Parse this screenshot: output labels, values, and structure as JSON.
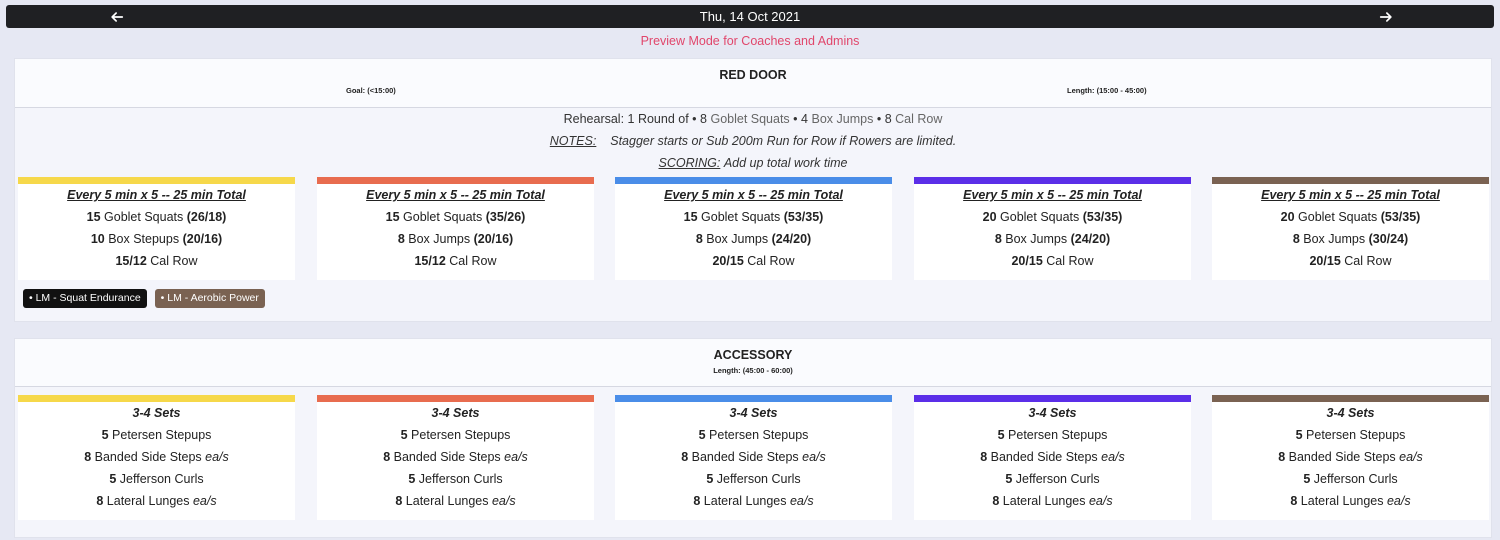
{
  "topbar": {
    "date": "Thu, 14 Oct 2021",
    "prev_icon": "arrow-left-icon",
    "next_icon": "arrow-right-icon"
  },
  "preview_text": "Preview Mode for Coaches and Admins",
  "colors": [
    "#f6d84a",
    "#e86c4f",
    "#4a8de8",
    "#5b2ee8",
    "#7a6252"
  ],
  "red_door": {
    "title": "RED DOOR",
    "goal": "Goal: (<15:00)",
    "length": "Length: (15:00 - 45:00)",
    "rehearsal": {
      "prefix": "Rehearsal: 1 Round of •",
      "n1": "8",
      "i1": "Goblet Squats",
      "sep1": "•",
      "n2": "4",
      "i2": "Box Jumps",
      "sep2": "•",
      "n3": "8",
      "i3": "Cal Row"
    },
    "notes_label": "NOTES:",
    "notes_text": "Stagger starts or Sub 200m Run for Row if Rowers are limited.",
    "scoring_label": "SCORING:",
    "scoring_text": "Add up total work time",
    "columns": [
      {
        "heading": "Every 5 min x 5 -- 25 min Total",
        "rows": [
          {
            "n": "15",
            "name": "Goblet Squats",
            "w": "(26/18)"
          },
          {
            "n": "10",
            "name": "Box Stepups",
            "w": "(20/16)"
          },
          {
            "n": "15/12",
            "name": "Cal Row",
            "w": ""
          }
        ]
      },
      {
        "heading": "Every 5 min x 5 -- 25 min Total",
        "rows": [
          {
            "n": "15",
            "name": "Goblet Squats",
            "w": "(35/26)"
          },
          {
            "n": "8",
            "name": "Box Jumps",
            "w": "(20/16)"
          },
          {
            "n": "15/12",
            "name": "Cal Row",
            "w": ""
          }
        ]
      },
      {
        "heading": "Every 5 min x 5 -- 25 min Total",
        "rows": [
          {
            "n": "15",
            "name": "Goblet Squats",
            "w": "(53/35)"
          },
          {
            "n": "8",
            "name": "Box Jumps",
            "w": "(24/20)"
          },
          {
            "n": "20/15",
            "name": "Cal Row",
            "w": ""
          }
        ]
      },
      {
        "heading": "Every 5 min x 5 -- 25 min Total",
        "rows": [
          {
            "n": "20",
            "name": "Goblet Squats",
            "w": "(53/35)"
          },
          {
            "n": "8",
            "name": "Box Jumps",
            "w": "(24/20)"
          },
          {
            "n": "20/15",
            "name": "Cal Row",
            "w": ""
          }
        ]
      },
      {
        "heading": "Every 5 min x 5 -- 25 min Total",
        "rows": [
          {
            "n": "20",
            "name": "Goblet Squats",
            "w": "(53/35)"
          },
          {
            "n": "8",
            "name": "Box Jumps",
            "w": "(30/24)"
          },
          {
            "n": "20/15",
            "name": "Cal Row",
            "w": ""
          }
        ]
      }
    ],
    "tags": [
      {
        "label": "• LM - Squat Endurance",
        "color": "#111111"
      },
      {
        "label": "• LM - Aerobic Power",
        "color": "#7a6252"
      }
    ]
  },
  "accessory": {
    "title": "ACCESSORY",
    "length": "Length: (45:00 - 60:00)",
    "heading": "3-4 Sets",
    "rows": [
      {
        "n": "5",
        "name": "Petersen Stepups",
        "suffix": ""
      },
      {
        "n": "8",
        "name": "Banded Side Steps",
        "suffix": "ea/s"
      },
      {
        "n": "5",
        "name": "Jefferson Curls",
        "suffix": ""
      },
      {
        "n": "8",
        "name": "Lateral Lunges",
        "suffix": "ea/s"
      }
    ]
  }
}
